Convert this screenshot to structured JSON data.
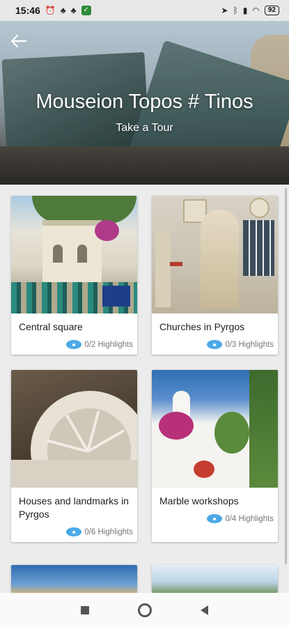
{
  "status_bar": {
    "time": "15:46",
    "battery": "92"
  },
  "header": {
    "title": "Mouseion Topos # Tinos",
    "subtitle": "Take a Tour",
    "back_icon": "arrow-left-icon"
  },
  "cards": [
    {
      "title": "Central square",
      "highlights": "0/2 Highlights"
    },
    {
      "title": "Churches in Pyrgos",
      "highlights": "0/3 Highlights"
    },
    {
      "title": "Houses and landmarks in Pyrgos",
      "highlights": "0/6 Highlights"
    },
    {
      "title": "Marble workshops",
      "highlights": "0/4 Highlights"
    }
  ],
  "colors": {
    "eye_icon": "#4aa8e8",
    "background": "#ececec"
  }
}
